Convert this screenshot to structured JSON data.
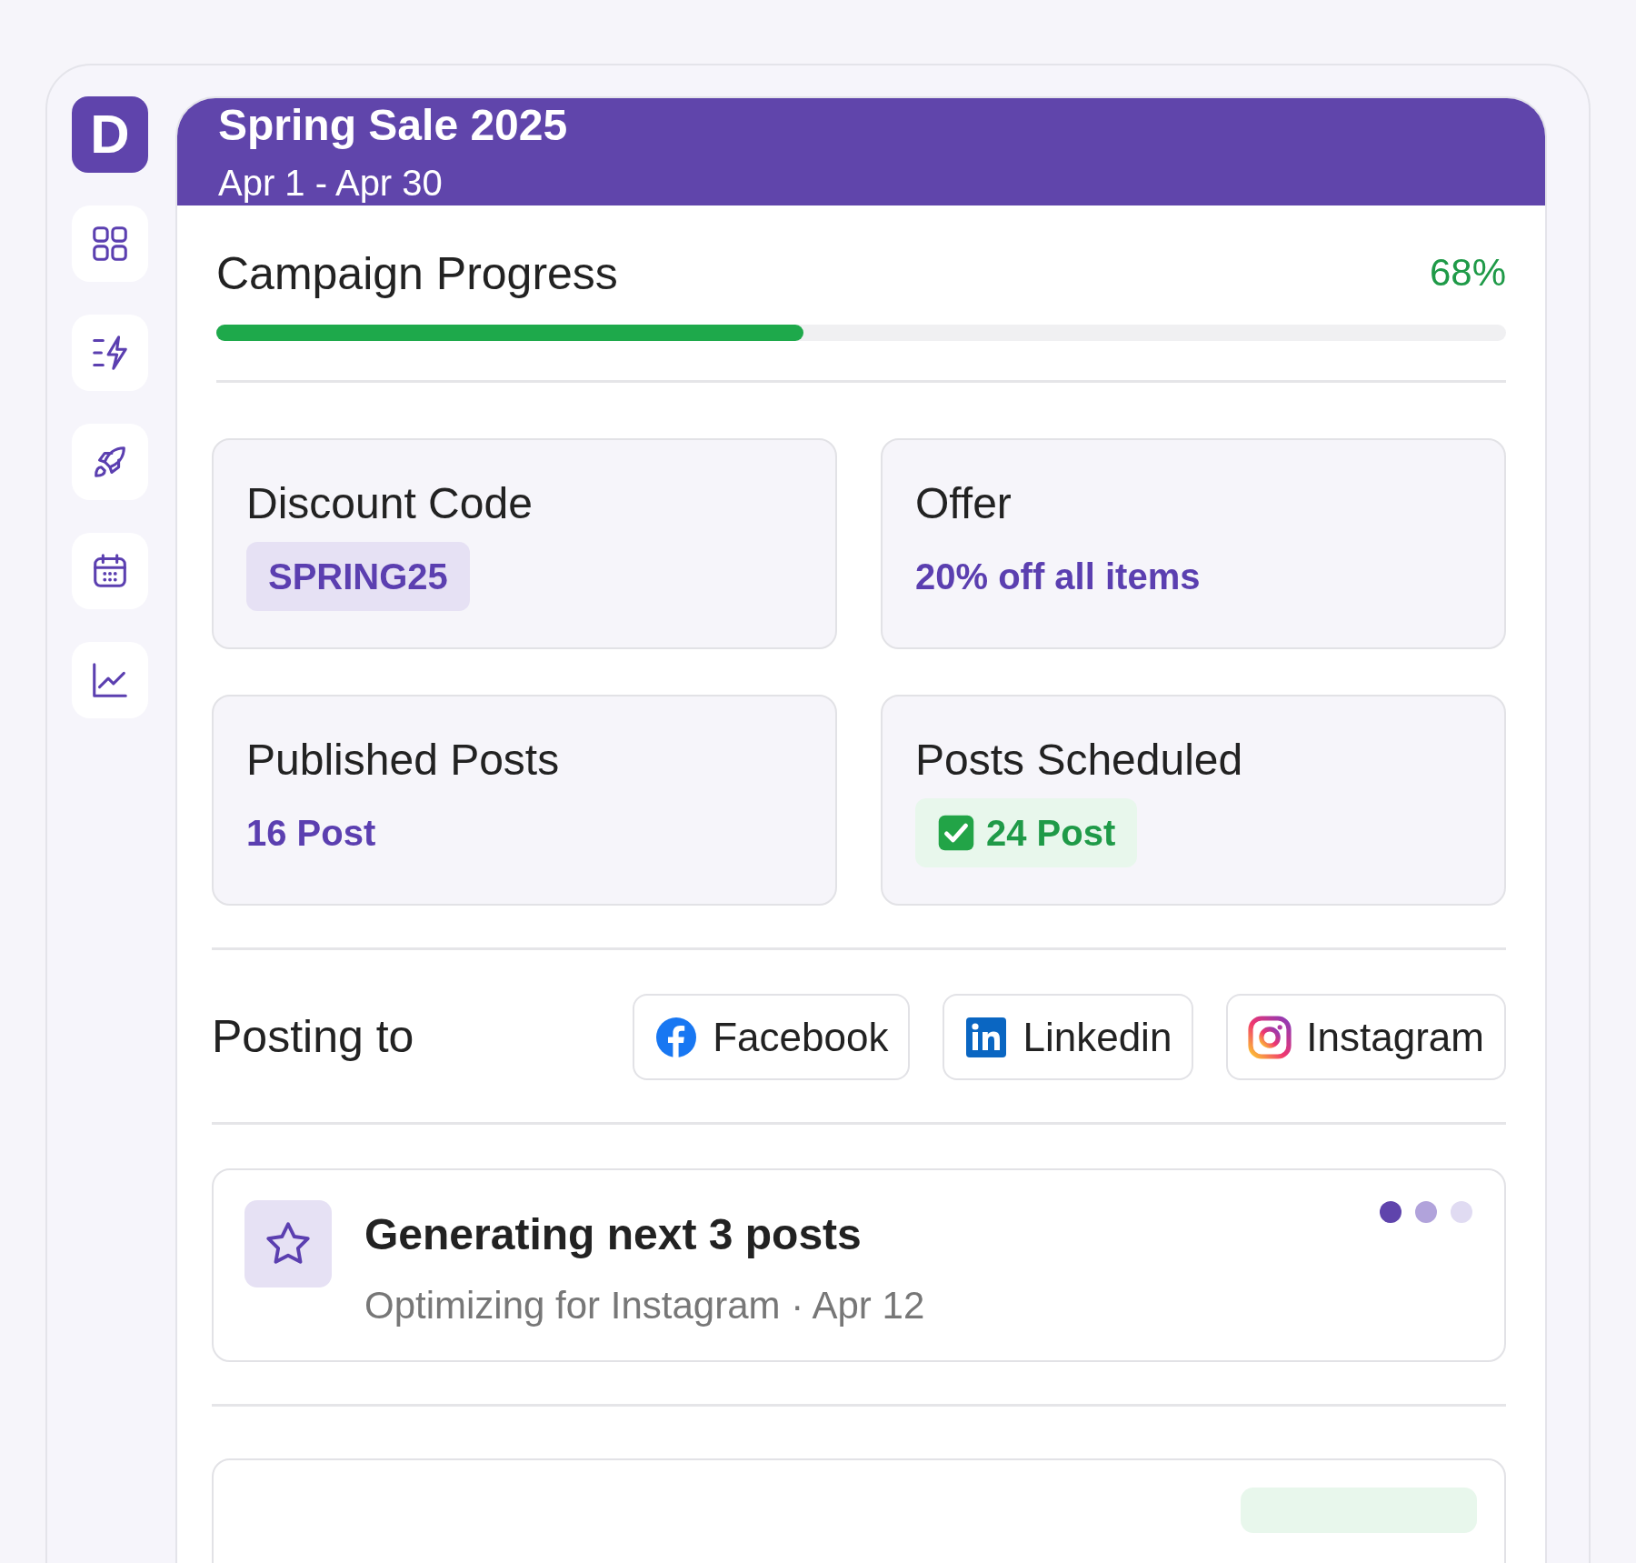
{
  "sidebar": {
    "logo": "D",
    "items": [
      {
        "kind": "grid"
      },
      {
        "kind": "bolt"
      },
      {
        "kind": "rocket"
      },
      {
        "kind": "calendar"
      },
      {
        "kind": "chart"
      }
    ]
  },
  "header": {
    "title": "Spring Sale 2025",
    "dates": "Apr 1 - Apr 30"
  },
  "progress": {
    "label": "Campaign Progress",
    "reading": "68%",
    "level": 0.455
  },
  "cards": [
    {
      "label": "Discount Code",
      "value": "SPRING25",
      "kind": "code"
    },
    {
      "label": "Offer",
      "value": "20% off all items",
      "kind": "text"
    },
    {
      "label": "Published Posts",
      "value": "16 Post",
      "kind": "text"
    },
    {
      "label": "Posts Scheduled",
      "value": "24 Post",
      "kind": "check"
    }
  ],
  "posting": {
    "label": "Posting to",
    "channels": [
      {
        "name": "Facebook",
        "kind": "facebook"
      },
      {
        "name": "Linkedin",
        "kind": "linkedin"
      },
      {
        "name": "Instagram",
        "kind": "instagram"
      }
    ]
  },
  "activity": {
    "title": "Generating next 3 posts",
    "subtitle": "Optimizing for Instagram · Apr 12"
  }
}
